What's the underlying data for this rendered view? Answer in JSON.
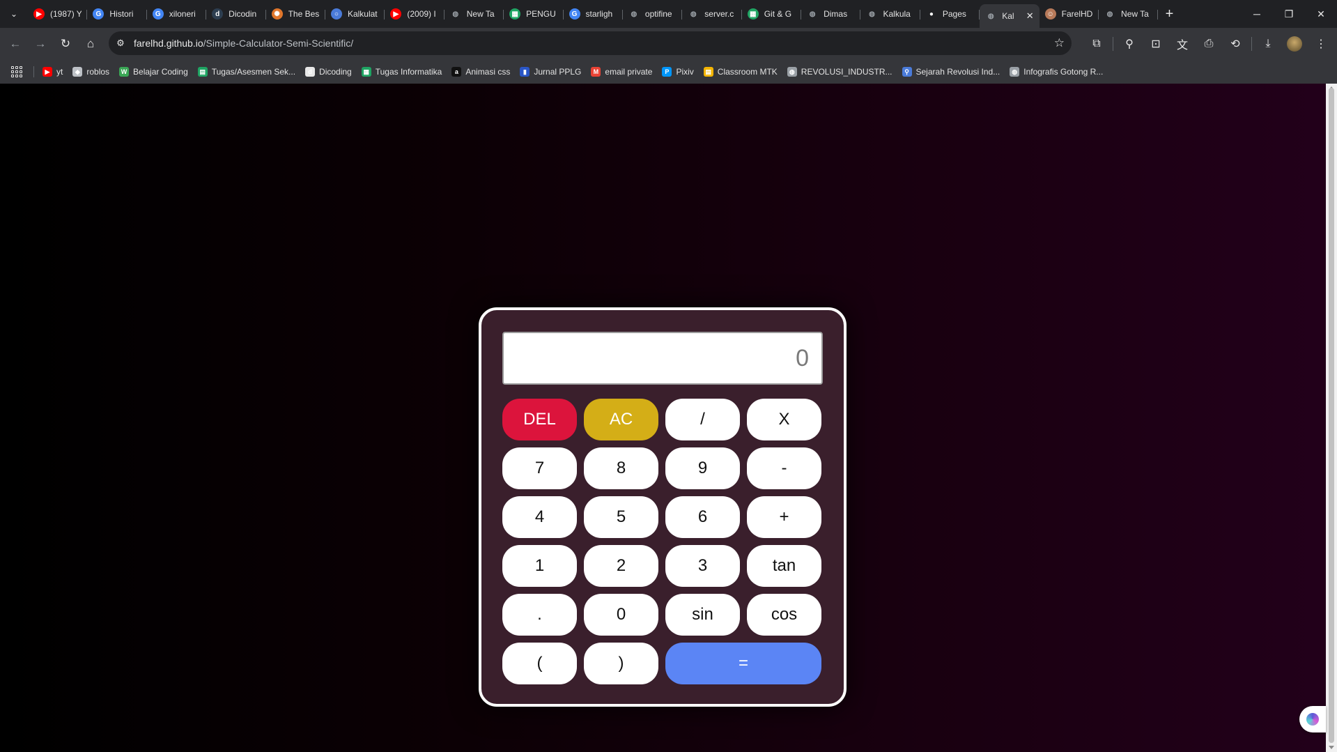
{
  "browser": {
    "tabs": [
      {
        "title": "(1987) Y",
        "icon": "youtube-icon",
        "color": "#ff0000"
      },
      {
        "title": "Histori",
        "icon": "google-icon",
        "color": "#4285f4"
      },
      {
        "title": "xiloneri",
        "icon": "google-icon",
        "color": "#4285f4"
      },
      {
        "title": "Dicodin",
        "icon": "dicoding-icon",
        "color": "#2d3e50"
      },
      {
        "title": "The Bes",
        "icon": "gear-wheel-icon",
        "color": "#e0762b"
      },
      {
        "title": "Kalkulat",
        "icon": "circle-icon",
        "color": "#4a7bd9"
      },
      {
        "title": "(2009) I",
        "icon": "youtube-icon",
        "color": "#ff0000"
      },
      {
        "title": "New Ta",
        "icon": "globe-icon",
        "color": "#9aa0a6"
      },
      {
        "title": "PENGU",
        "icon": "sheets-icon",
        "color": "#1fa463"
      },
      {
        "title": "starligh",
        "icon": "google-icon",
        "color": "#4285f4"
      },
      {
        "title": "optifine",
        "icon": "globe-icon",
        "color": "#9aa0a6"
      },
      {
        "title": "server.c",
        "icon": "globe-icon",
        "color": "#9aa0a6"
      },
      {
        "title": "Git & G",
        "icon": "sheets-icon",
        "color": "#1fa463"
      },
      {
        "title": "Dimas",
        "icon": "globe-icon",
        "color": "#9aa0a6"
      },
      {
        "title": "Kalkula",
        "icon": "globe-icon",
        "color": "#9aa0a6"
      },
      {
        "title": "Pages",
        "icon": "github-icon",
        "color": "#ffffff"
      },
      {
        "title": "Kal",
        "icon": "globe-icon",
        "color": "#9aa0a6",
        "active": true
      },
      {
        "title": "FarelHD",
        "icon": "avatar-icon",
        "color": "#b77a5a"
      },
      {
        "title": "New Ta",
        "icon": "globe-icon",
        "color": "#9aa0a6"
      }
    ],
    "new_tab_label": "+",
    "url_host": "farelhd.github.io",
    "url_path": "/Simple-Calculator-Semi-Scientific/",
    "bookmarks": [
      {
        "label": "yt",
        "icon": "youtube-icon",
        "color": "#ff0000"
      },
      {
        "label": "roblos",
        "icon": "roblox-icon",
        "color": "#bdc1c6"
      },
      {
        "label": "Belajar Coding",
        "icon": "w-icon",
        "color": "#3aa655"
      },
      {
        "label": "Tugas/Asesmen Sek...",
        "icon": "classroom-icon",
        "color": "#1fa463"
      },
      {
        "label": "Dicoding",
        "icon": "dicoding-icon",
        "color": "#e8e8e8"
      },
      {
        "label": "Tugas Informatika",
        "icon": "sheets-icon",
        "color": "#1fa463"
      },
      {
        "label": "Animasi css",
        "icon": "amazon-icon",
        "color": "#111111"
      },
      {
        "label": "Jurnal PPLG",
        "icon": "doc-icon",
        "color": "#2a56c6"
      },
      {
        "label": "email private",
        "icon": "gmail-icon",
        "color": "#ea4335"
      },
      {
        "label": "Pixiv",
        "icon": "pixiv-icon",
        "color": "#0096fa"
      },
      {
        "label": "Classroom MTK",
        "icon": "classroom-icon",
        "color": "#f4b400"
      },
      {
        "label": "REVOLUSI_INDUSTR...",
        "icon": "globe-icon",
        "color": "#9aa0a6"
      },
      {
        "label": "Sejarah Revolusi Ind...",
        "icon": "person-icon",
        "color": "#4a7bd9"
      },
      {
        "label": "Infografis Gotong R...",
        "icon": "globe-icon",
        "color": "#9aa0a6"
      }
    ]
  },
  "calculator": {
    "display_value": "0",
    "keys": [
      {
        "label": "DEL",
        "type": "del"
      },
      {
        "label": "AC",
        "type": "ac"
      },
      {
        "label": "/",
        "type": "op"
      },
      {
        "label": "X",
        "type": "op"
      },
      {
        "label": "7",
        "type": "num"
      },
      {
        "label": "8",
        "type": "num"
      },
      {
        "label": "9",
        "type": "num"
      },
      {
        "label": "-",
        "type": "op"
      },
      {
        "label": "4",
        "type": "num"
      },
      {
        "label": "5",
        "type": "num"
      },
      {
        "label": "6",
        "type": "num"
      },
      {
        "label": "+",
        "type": "op"
      },
      {
        "label": "1",
        "type": "num"
      },
      {
        "label": "2",
        "type": "num"
      },
      {
        "label": "3",
        "type": "num"
      },
      {
        "label": "tan",
        "type": "fn"
      },
      {
        "label": ".",
        "type": "num"
      },
      {
        "label": "0",
        "type": "num"
      },
      {
        "label": "sin",
        "type": "fn"
      },
      {
        "label": "cos",
        "type": "fn"
      },
      {
        "label": "(",
        "type": "num"
      },
      {
        "label": ")",
        "type": "num"
      },
      {
        "label": "=",
        "type": "equals"
      }
    ],
    "colors": {
      "del": "#dc143c",
      "ac": "#d4ae17",
      "equals": "#5b85f5",
      "panel": "#3a1f2c"
    }
  }
}
